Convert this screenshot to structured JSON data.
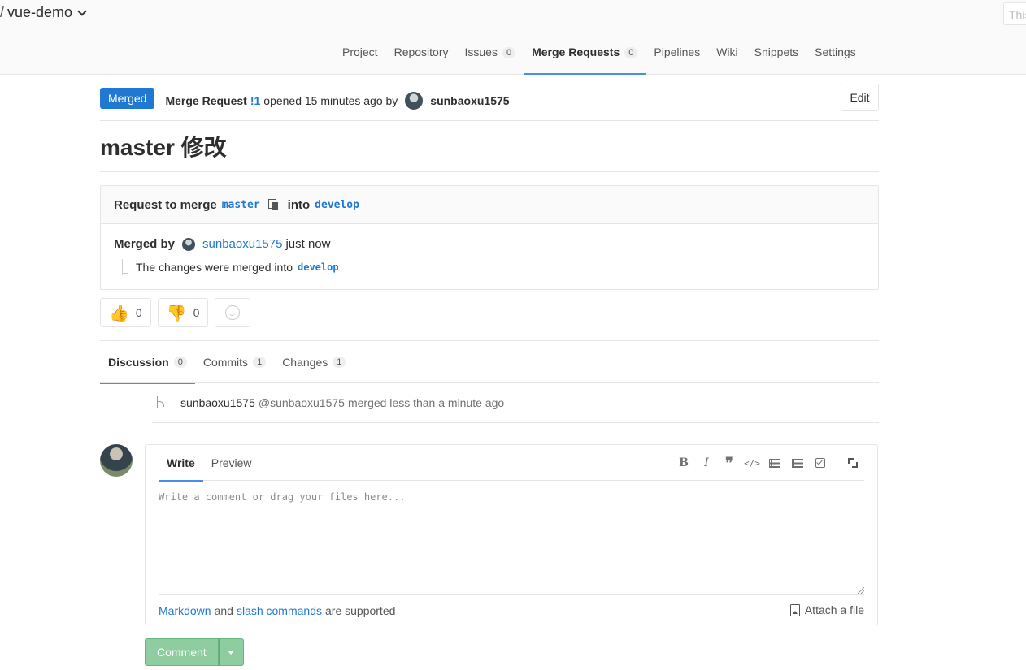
{
  "header": {
    "project_slash": "/",
    "project_name": "vue-demo",
    "search_placeholder": "This"
  },
  "nav": {
    "items": [
      {
        "label": "Project"
      },
      {
        "label": "Repository"
      },
      {
        "label": "Issues",
        "count": "0"
      },
      {
        "label": "Merge Requests",
        "count": "0"
      },
      {
        "label": "Pipelines"
      },
      {
        "label": "Wiki"
      },
      {
        "label": "Snippets"
      },
      {
        "label": "Settings"
      }
    ]
  },
  "mr": {
    "status": "Merged",
    "label": "Merge Request",
    "id": "!1",
    "opened_text": "opened 15 minutes ago by",
    "author": "sunbaoxu1575",
    "edit_label": "Edit",
    "title": "master 修改"
  },
  "widget": {
    "request_prefix": "Request to merge",
    "source_branch": "master",
    "into": "into",
    "target_branch": "develop",
    "merged_by": "Merged by",
    "merger": "sunbaoxu1575",
    "merged_when": "just now",
    "merged_sub": "The changes were merged into",
    "merged_sub_branch": "develop"
  },
  "awards": {
    "thumbs_up_count": "0",
    "thumbs_down_count": "0"
  },
  "tabs": [
    {
      "label": "Discussion",
      "count": "0"
    },
    {
      "label": "Commits",
      "count": "1"
    },
    {
      "label": "Changes",
      "count": "1"
    }
  ],
  "note": {
    "author": "sunbaoxu1575",
    "handle": "@sunbaoxu1575",
    "action": "merged less than a minute ago"
  },
  "comment": {
    "write_tab": "Write",
    "preview_tab": "Preview",
    "placeholder": "Write a comment or drag your files here...",
    "footer_markdown": "Markdown",
    "footer_and": "and",
    "footer_slash": "slash commands",
    "footer_supported": "are supported",
    "attach_label": "Attach a file",
    "submit_label": "Comment"
  }
}
